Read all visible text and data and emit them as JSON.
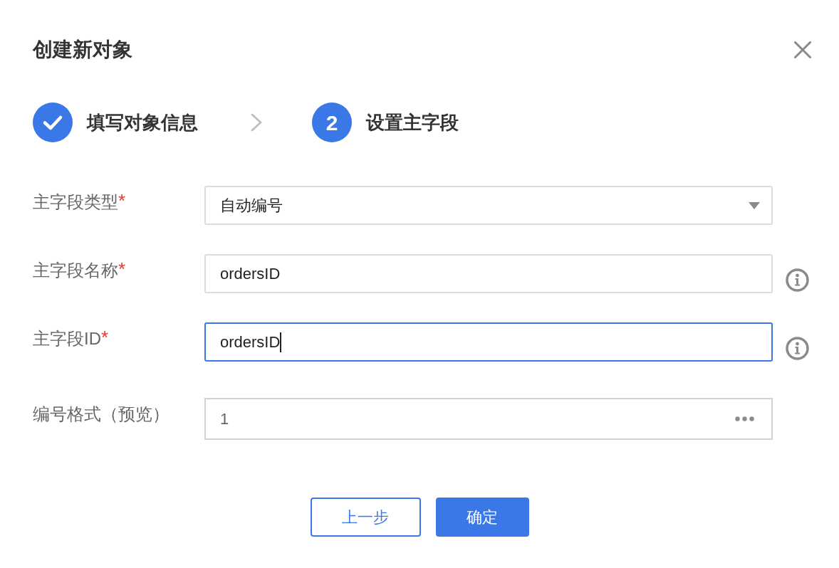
{
  "dialog": {
    "title": "创建新对象"
  },
  "steps": [
    {
      "label": "填写对象信息",
      "completed": true
    },
    {
      "label": "设置主字段",
      "completed": false,
      "number": "2"
    }
  ],
  "fields": [
    {
      "kind": "select",
      "label": "主字段类型",
      "required_mark": "*",
      "value": "自动编号",
      "focused": false,
      "info": false
    },
    {
      "kind": "text",
      "label": "主字段名称",
      "required_mark": "*",
      "value": "ordersID",
      "focused": false,
      "info": true
    },
    {
      "kind": "text",
      "label": "主字段ID",
      "required_mark": "*",
      "value": "ordersID",
      "focused": true,
      "info": true
    },
    {
      "kind": "picker",
      "label": "编号格式（预览）",
      "value": "1",
      "focused": false,
      "info": false
    }
  ],
  "buttons": [
    {
      "label": "上一步",
      "kind": "secondary"
    },
    {
      "label": "确定",
      "kind": "primary"
    }
  ]
}
